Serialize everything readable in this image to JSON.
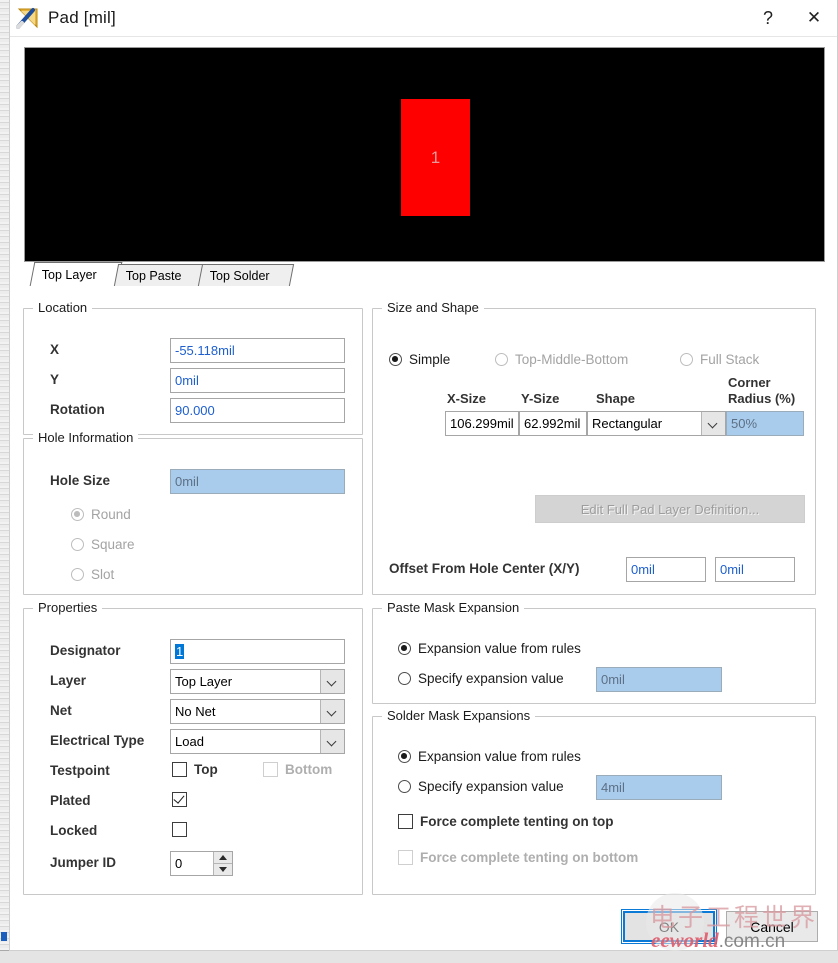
{
  "window": {
    "title": "Pad [mil]",
    "icon": "pad-ruler-icon",
    "help_label": "?",
    "close_label": "✕"
  },
  "preview": {
    "pad_designator": "1",
    "pad_color": "#ff0000",
    "background_color": "#000000",
    "tabs": [
      {
        "label": "Top Layer",
        "active": true
      },
      {
        "label": "Top Paste",
        "active": false
      },
      {
        "label": "Top Solder",
        "active": false
      }
    ]
  },
  "location": {
    "legend": "Location",
    "x_label": "X",
    "x_value": "-55.118mil",
    "y_label": "Y",
    "y_value": "0mil",
    "rotation_label": "Rotation",
    "rotation_value": "90.000"
  },
  "hole_information": {
    "legend": "Hole Information",
    "hole_size_label": "Hole Size",
    "hole_size_value": "0mil",
    "shapes": [
      {
        "label": "Round",
        "selected": true
      },
      {
        "label": "Square",
        "selected": false
      },
      {
        "label": "Slot",
        "selected": false
      }
    ]
  },
  "properties": {
    "legend": "Properties",
    "designator_label": "Designator",
    "designator_value": "1",
    "layer_label": "Layer",
    "layer_value": "Top Layer",
    "net_label": "Net",
    "net_value": "No Net",
    "electrical_type_label": "Electrical Type",
    "electrical_type_value": "Load",
    "testpoint_label": "Testpoint",
    "testpoint_top_label": "Top",
    "testpoint_bottom_label": "Bottom",
    "plated_label": "Plated",
    "locked_label": "Locked",
    "jumper_id_label": "Jumper ID",
    "jumper_id_value": "0"
  },
  "size_and_shape": {
    "legend": "Size and Shape",
    "mode_simple": "Simple",
    "mode_tmb": "Top-Middle-Bottom",
    "mode_full_stack": "Full Stack",
    "col_x_size": "X-Size",
    "col_y_size": "Y-Size",
    "col_shape": "Shape",
    "col_corner_radius_line1": "Corner",
    "col_corner_radius_line2": "Radius (%)",
    "x_size_value": "106.299mil",
    "y_size_value": "62.992mil",
    "shape_value": "Rectangular",
    "corner_radius_value": "50%",
    "edit_full_pad_label": "Edit Full Pad Layer Definition...",
    "offset_label": "Offset From Hole Center (X/Y)",
    "offset_x_value": "0mil",
    "offset_y_value": "0mil"
  },
  "paste_mask": {
    "legend": "Paste Mask Expansion",
    "from_rules_label": "Expansion value from rules",
    "specify_label": "Specify expansion value",
    "specify_value": "0mil"
  },
  "solder_mask": {
    "legend": "Solder Mask Expansions",
    "from_rules_label": "Expansion value from rules",
    "specify_label": "Specify expansion value",
    "specify_value": "4mil",
    "tenting_top_label": "Force complete tenting on top",
    "tenting_bottom_label": "Force complete tenting on bottom"
  },
  "footer": {
    "ok_label": "OK",
    "cancel_label": "Cancel"
  },
  "watermark": {
    "chinese": "电子工程世界",
    "site": "eeworld",
    "domain": ".com.cn"
  },
  "colors": {
    "accent_blue": "#0078d7",
    "field_text_blue": "#1e5fd0",
    "disabled_field_bg": "#a9cced",
    "pad_red": "#ff0000",
    "focus_border": "#0a7ad6"
  }
}
